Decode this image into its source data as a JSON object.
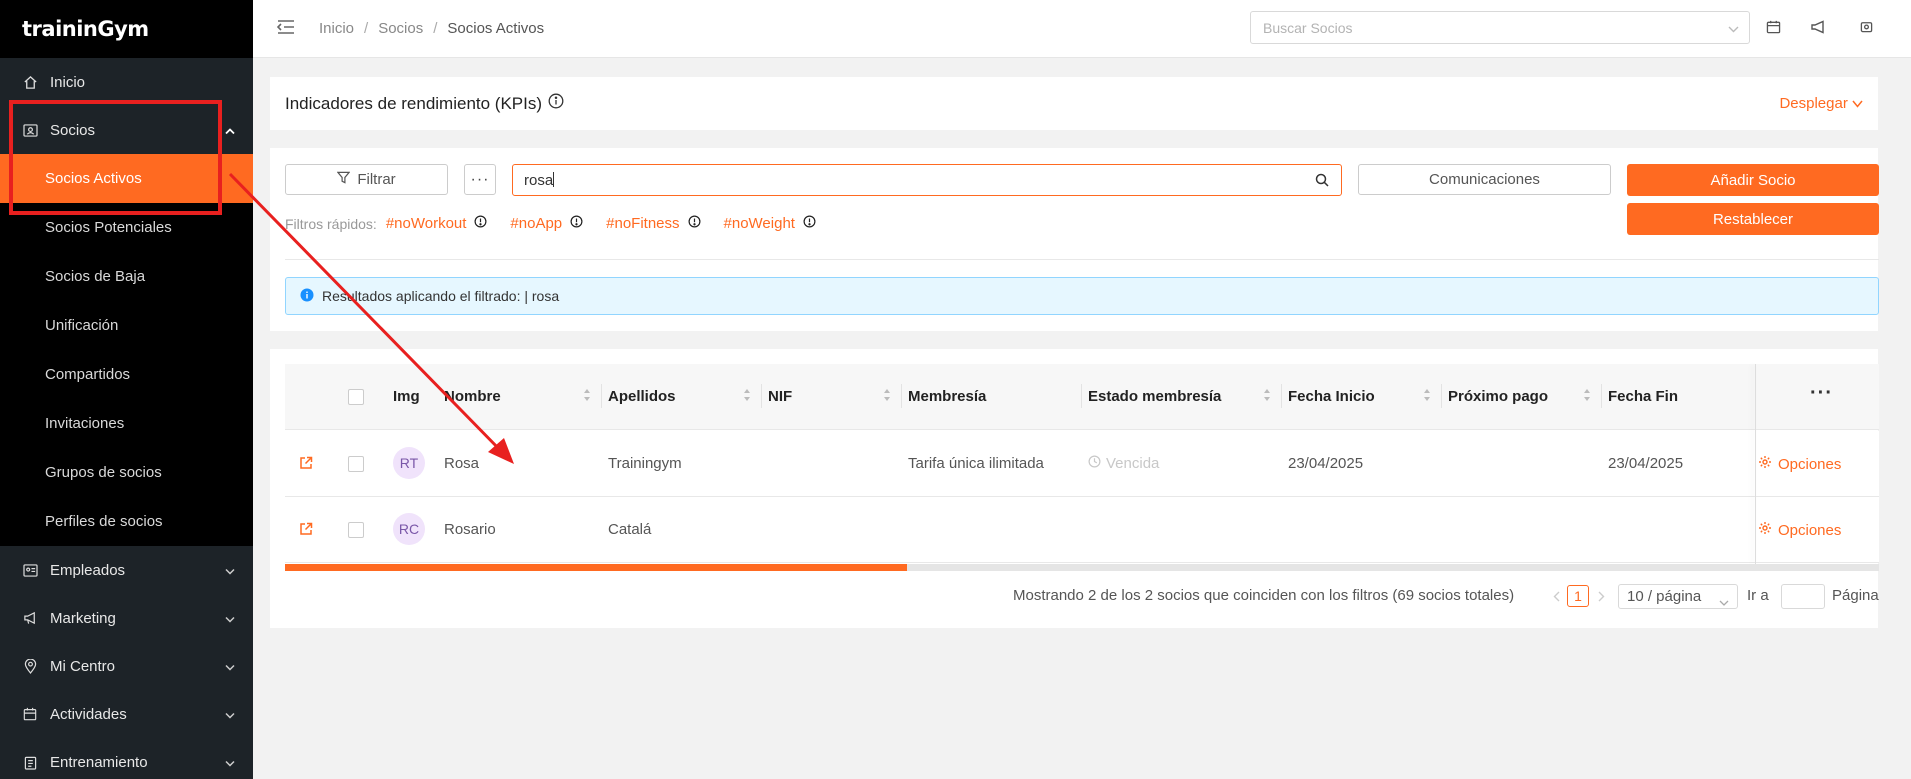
{
  "app": {
    "logo": "traininGym"
  },
  "sidebar": {
    "top_items": [
      {
        "label": "Inicio",
        "icon": "home-icon"
      },
      {
        "label": "Socios",
        "icon": "id-card-icon"
      }
    ],
    "socios_submenu": [
      "Socios Activos",
      "Socios Potenciales",
      "Socios de Baja",
      "Unificación",
      "Compartidos",
      "Invitaciones",
      "Grupos de socios",
      "Perfiles de socios"
    ],
    "lower_items": [
      {
        "label": "Empleados",
        "icon": "employee-card-icon"
      },
      {
        "label": "Marketing",
        "icon": "megaphone-icon"
      },
      {
        "label": "Mi Centro",
        "icon": "location-pin-icon"
      },
      {
        "label": "Actividades",
        "icon": "calendar-icon"
      },
      {
        "label": "Entrenamiento",
        "icon": "clipboard-icon"
      }
    ]
  },
  "header": {
    "breadcrumb": [
      "Inicio",
      "Socios",
      "Socios Activos"
    ],
    "search_placeholder": "Buscar Socios"
  },
  "kpi": {
    "title": "Indicadores de rendimiento (KPIs)",
    "expand_label": "Desplegar"
  },
  "filters": {
    "filter_button": "Filtrar",
    "search_value": "rosa",
    "communications_button": "Comunicaciones",
    "add_button": "Añadir Socio",
    "reset_button": "Restablecer",
    "quick_label": "Filtros rápidos:",
    "quick_tags": [
      "#noWorkout",
      "#noApp",
      "#noFitness",
      "#noWeight"
    ],
    "info_message": "Resultados aplicando el filtrado: | rosa"
  },
  "table": {
    "columns": {
      "img": "Img",
      "nombre": "Nombre",
      "apellidos": "Apellidos",
      "nif": "NIF",
      "membresia": "Membresía",
      "estado": "Estado membresía",
      "fecha_inicio": "Fecha Inicio",
      "proximo_pago": "Próximo pago",
      "fecha_fin": "Fecha Fin"
    },
    "rows": [
      {
        "initials": "RT",
        "nombre": "Rosa",
        "apellidos": "Trainingym",
        "nif": "",
        "membresia": "Tarifa única ilimitada",
        "estado": "Vencida",
        "fecha_inicio": "23/04/2025",
        "proximo_pago": "",
        "fecha_fin": "23/04/2025",
        "options": "Opciones"
      },
      {
        "initials": "RC",
        "nombre": "Rosario",
        "apellidos": "Catalá",
        "nif": "",
        "membresia": "",
        "estado": "",
        "fecha_inicio": "",
        "proximo_pago": "",
        "fecha_fin": "",
        "options": "Opciones"
      }
    ],
    "scroll_fraction": 0.39
  },
  "pagination": {
    "summary": "Mostrando 2 de los 2 socios que coinciden con los filtros (69 socios totales)",
    "current_page": "1",
    "page_size": "10 / página",
    "goto_label": "Ir a",
    "page_label": "Página"
  },
  "colors": {
    "accent": "#ff6a21",
    "sidebar_bg": "#151c21",
    "annotation": "#e8201f"
  }
}
